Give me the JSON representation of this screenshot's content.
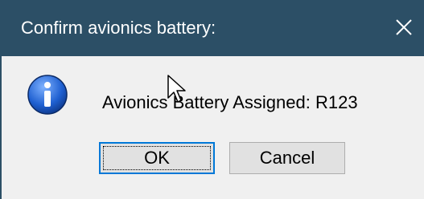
{
  "window": {
    "title": "Confirm avionics battery:",
    "close_label": "×"
  },
  "dialog": {
    "icon": "information-icon",
    "message": "Avionics Battery Assigned: R123",
    "ok_label": "OK",
    "cancel_label": "Cancel"
  },
  "colors": {
    "titlebar": "#2c4f66",
    "body": "#f0f0f0",
    "focus_border": "#0078d7"
  }
}
